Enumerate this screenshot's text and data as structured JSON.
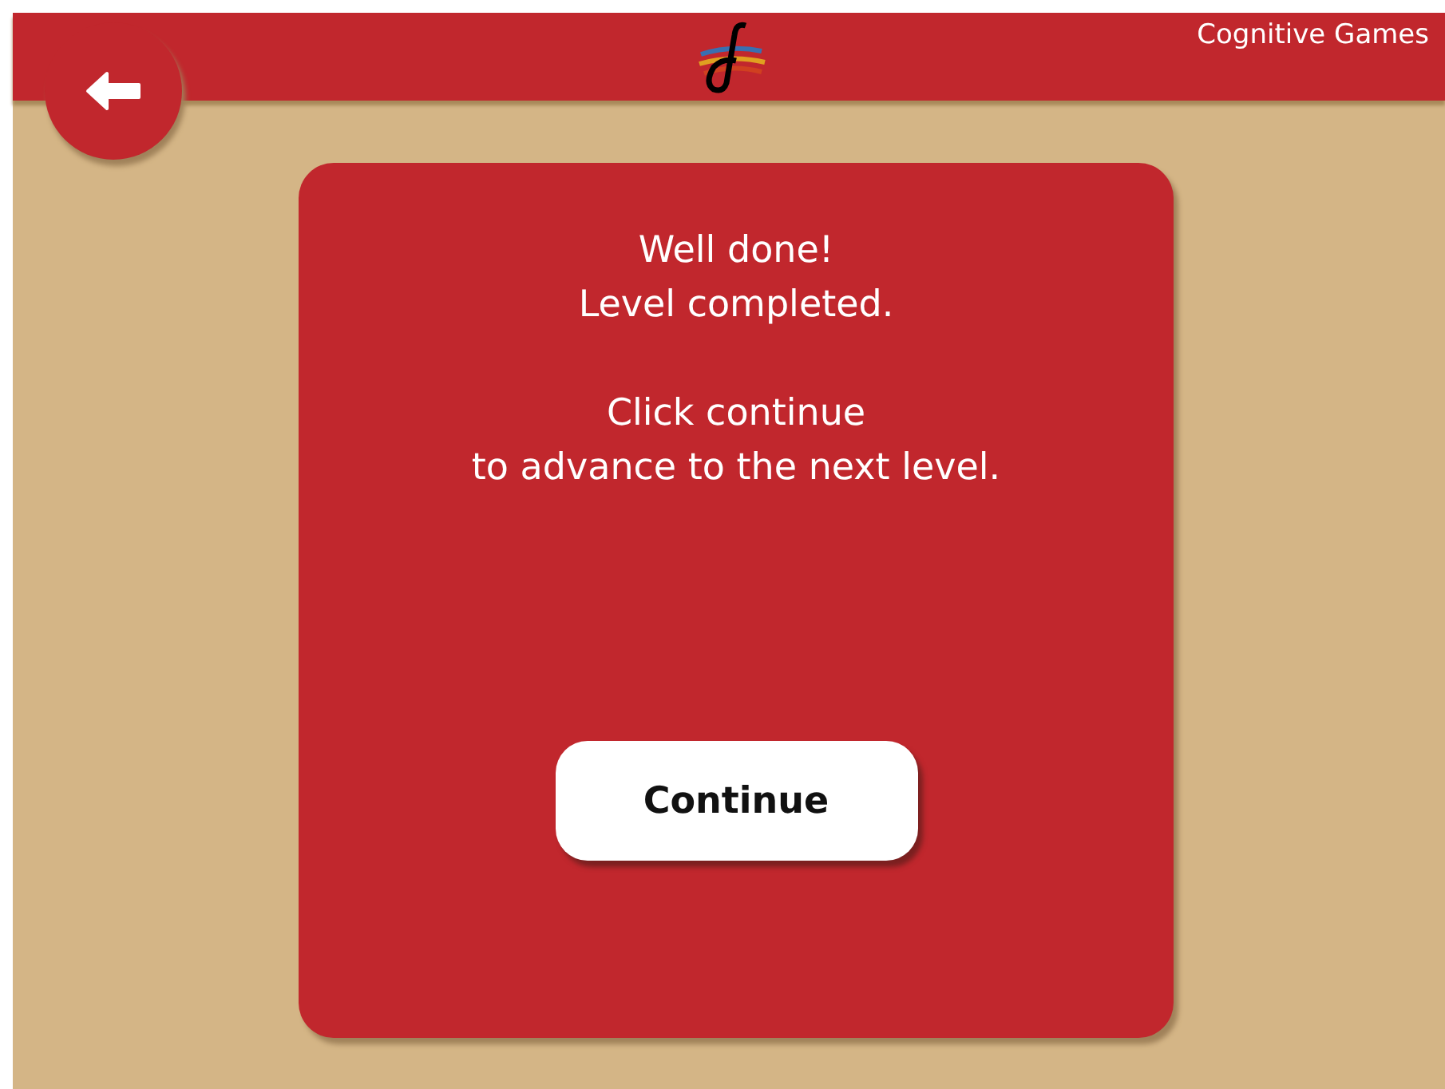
{
  "header": {
    "title": "Cognitive Games"
  },
  "dialog": {
    "paragraphs": [
      "Well done!\nLevel completed.",
      "Click continue\nto advance to the next level."
    ],
    "button": "Continue"
  }
}
